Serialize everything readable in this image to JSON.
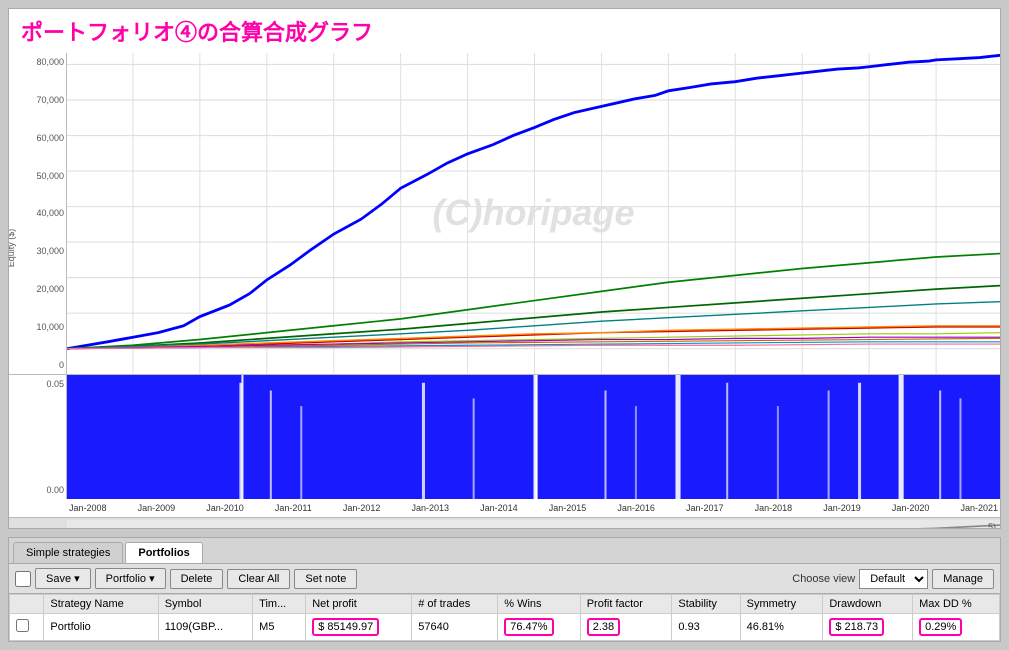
{
  "title": "ポートフォリオ④の合算合成グラフ",
  "watermark": "(C)horipage",
  "yaxis_labels": [
    "80,000",
    "70,000",
    "60,000",
    "50,000",
    "40,000",
    "30,000",
    "20,000",
    "10,000",
    "0"
  ],
  "yaxis_equity_label": "Equity ($)",
  "yaxis_vol_labels": [
    "0.05",
    "0.00"
  ],
  "xaxis_labels": [
    "Jan-2008",
    "Jan-2009",
    "Jan-2010",
    "Jan-2011",
    "Jan-2012",
    "Jan-2013",
    "Jan-2014",
    "Jan-2015",
    "Jan-2016",
    "Jan-2017",
    "Jan-2018",
    "Jan-2019",
    "Jan-2020",
    "Jan-2021"
  ],
  "tabs": [
    {
      "label": "Simple strategies",
      "active": false
    },
    {
      "label": "Portfolios",
      "active": true
    }
  ],
  "toolbar": {
    "save_label": "Save ▾",
    "portfolio_label": "Portfolio ▾",
    "delete_label": "Delete",
    "clear_all_label": "Clear All",
    "set_note_label": "Set note",
    "choose_view_label": "Choose view",
    "default_option": "Default",
    "manage_label": "Manage"
  },
  "table": {
    "headers": [
      "",
      "Strategy Name",
      "Symbol",
      "Tim...",
      "Net profit",
      "# of trades",
      "% Wins",
      "Profit factor",
      "Stability",
      "Symmetry",
      "Drawdown",
      "Max DD %"
    ],
    "rows": [
      {
        "checkbox": false,
        "strategy_name": "Portfolio",
        "symbol": "1109(GBP...",
        "timeframe": "M5",
        "net_profit": "$ 85149.97",
        "num_trades": "57640",
        "pct_wins": "76.47%",
        "profit_factor": "2.38",
        "stability": "0.93",
        "symmetry": "46.81%",
        "drawdown": "$ 218.73",
        "max_dd": "0.29%"
      }
    ]
  }
}
